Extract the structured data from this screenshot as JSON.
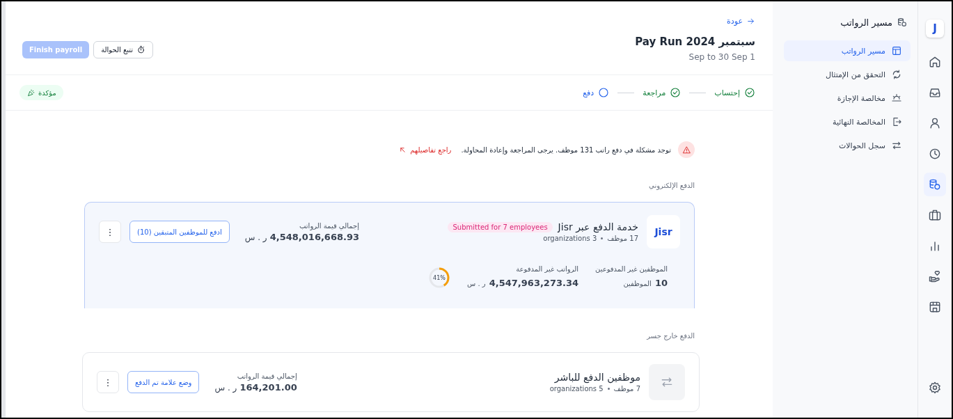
{
  "rail": {
    "logo": "J",
    "items": [
      {
        "kind": "home",
        "selected": false
      },
      {
        "kind": "inbox",
        "selected": false
      },
      {
        "kind": "person",
        "selected": false
      },
      {
        "kind": "clock",
        "selected": false
      },
      {
        "kind": "payroll",
        "selected": true
      },
      {
        "kind": "briefcase",
        "selected": false
      },
      {
        "kind": "chart",
        "selected": false
      },
      {
        "kind": "hand",
        "selected": false
      },
      {
        "kind": "store",
        "selected": false
      }
    ],
    "settings": {
      "kind": "gear"
    }
  },
  "sidebar": {
    "title": "مسير الرواتب",
    "items": [
      {
        "label": "مسير الرواتب",
        "kind": "table",
        "selected": true
      },
      {
        "label": "التحقق من الإمتثال",
        "kind": "refresh",
        "selected": false
      },
      {
        "label": "مخالصة الإجازة",
        "kind": "sunset",
        "selected": false
      },
      {
        "label": "المخالصة النهائية",
        "kind": "exit",
        "selected": false
      },
      {
        "label": "سجل الحوالات",
        "kind": "swap",
        "selected": false
      }
    ]
  },
  "header": {
    "back": "عودة",
    "title": "سبتمبر Pay Run 2024",
    "period": "Sep to 30 Sep 1",
    "track_button": "تتبع الحوالة",
    "finish_button": {
      "label": "Finish payroll",
      "disabled": true
    }
  },
  "steps": [
    {
      "label": "إحتساب",
      "done": true
    },
    {
      "label": "مراجعة",
      "done": true
    },
    {
      "label": "دفع",
      "done": false
    }
  ],
  "status_badge": "مؤكدة",
  "alert": {
    "message": "توجد مشكلة في دفع راتب 131 موظف. يرجى المراجعة وإعادة المحاولة.",
    "link": "راجع تفاصيلهم"
  },
  "sections": [
    {
      "heading": "الدفع الإلكتروني",
      "card": {
        "kind": "jisr",
        "logo": "Jisr",
        "name": "خدمة الدفع عبر Jisr",
        "badge": "Submitted for 7 employees",
        "employees": "17 موظف",
        "organizations": "organizations 3",
        "total_label": "إجمالي قيمة الرواتب",
        "total": "4,548,016,668.93",
        "currency": "ر . س",
        "action": "ادفع للموظفين المتبقين (10)",
        "more": "⋮",
        "unpaid": {
          "employees_label": "الموظفين غير المدفوعين",
          "employees_value": "10",
          "employees_unit": "الموظفين",
          "salaries_label": "الرواتب غير المدفوعة",
          "salaries_value": "4,547,963,273.34",
          "currency": "ر . س",
          "progress": {
            "level": 0.41,
            "text": "41%"
          }
        }
      }
    },
    {
      "heading": "الدفع خارج جسر",
      "card": {
        "kind": "direct",
        "name": "موظفين الدفع للباشر",
        "employees": "7 موظف",
        "organizations": "organizations 5",
        "total_label": "إجمالي قيمة الرواتب",
        "total": "164,201.00",
        "currency": "ر . س",
        "action": "وضع علامة تم الدفع",
        "more": "⋮"
      }
    }
  ]
}
